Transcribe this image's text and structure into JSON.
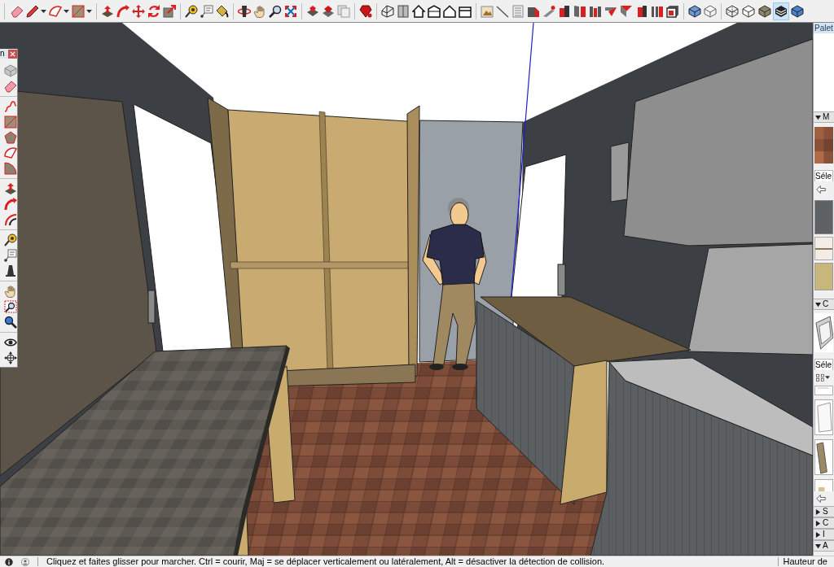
{
  "toolbar": {
    "style_buttons": [
      {
        "selected": false
      },
      {
        "selected": false
      },
      {
        "selected": false
      },
      {
        "selected": true
      },
      {
        "selected": false
      }
    ]
  },
  "tool_palette": {
    "title": "n"
  },
  "tray": {
    "title": "Palet",
    "sections": [
      {
        "title": "M",
        "expanded": true,
        "tab": "Séle"
      },
      {
        "title": "C",
        "expanded": true,
        "tab": "Séle"
      },
      {
        "title": "S",
        "expanded": false
      },
      {
        "title": "C",
        "expanded": false
      },
      {
        "title": "I",
        "expanded": false
      },
      {
        "title": "A",
        "expanded": true
      }
    ]
  },
  "status_bar": {
    "hint": "Cliquez et faites glisser pour marcher. Ctrl = courir, Maj = se déplacer verticalement ou latéralement, Alt = désactiver la détection de collision.",
    "measurement_label": "Hauteur de"
  }
}
